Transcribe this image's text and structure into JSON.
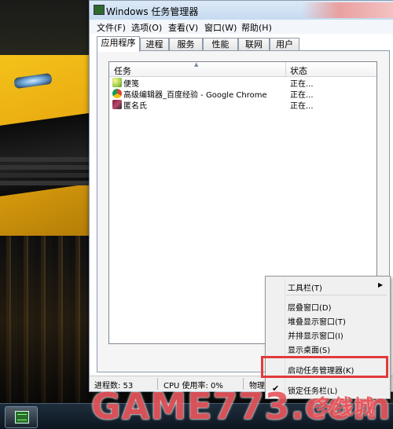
{
  "window": {
    "title": "Windows 任务管理器"
  },
  "menubar": [
    "文件(F)",
    "选项(O)",
    "查看(V)",
    "窗口(W)",
    "帮助(H)"
  ],
  "tabs": [
    "应用程序",
    "进程",
    "服务",
    "性能",
    "联网",
    "用户"
  ],
  "active_tab": "应用程序",
  "list": {
    "columns": [
      "任务",
      "状态"
    ],
    "rows": [
      {
        "name": "便笺",
        "status": "正在...",
        "icon": "sticky-notes-icon"
      },
      {
        "name": "高级编辑器_百度经验 - Google Chrome",
        "status": "正在...",
        "icon": "chrome-icon"
      },
      {
        "name": "匿名氏",
        "status": "正在...",
        "icon": "app-icon"
      }
    ]
  },
  "statusbar": {
    "processes": "进程数: 53",
    "cpu": "CPU 使用率: 0%",
    "memory": "物理"
  },
  "context_menu": {
    "items": [
      {
        "label": "工具栏(T)",
        "submenu": true
      },
      {
        "label": "层叠窗口(D)"
      },
      {
        "label": "堆叠显示窗口(T)"
      },
      {
        "label": "并排显示窗口(I)"
      },
      {
        "label": "显示桌面(S)"
      },
      {
        "label": "启动任务管理器(K)"
      },
      {
        "label": "锁定任务栏(L)",
        "checked": true
      }
    ],
    "highlight_color": "#e23a3a"
  },
  "watermark": {
    "brand": "GAME773.com",
    "cn": "多线城"
  },
  "colors": {
    "titlebar": "#c6daf0",
    "accent_red": "#e8565c"
  }
}
